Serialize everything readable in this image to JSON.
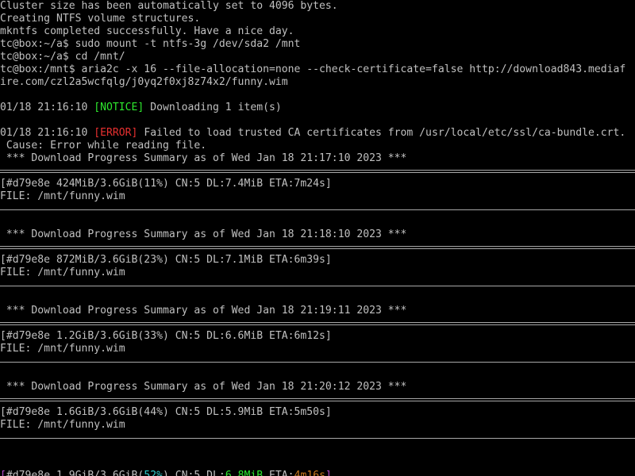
{
  "terminal": {
    "lines": [
      "Cluster size has been automatically set to 4096 bytes.",
      "Creating NTFS volume structures.",
      "mkntfs completed successfully. Have a nice day.",
      "tc@box:~/a$ sudo mount -t ntfs-3g /dev/sda2 /mnt",
      "tc@box:~/a$ cd /mnt/",
      "tc@box:/mnt$ aria2c -x 16 --file-allocation=none --check-certificate=false http://download843.mediaf",
      "ire.com/czl2a5wcfqlg/j0yq2f0xj8z74x2/funny.wim"
    ],
    "notice_line": {
      "time": "01/18 21:16:10 ",
      "tag": "[NOTICE]",
      "msg": " Downloading 1 item(s)"
    },
    "error_line": {
      "time": "01/18 21:16:10 ",
      "tag": "[ERROR]",
      "msg": " Failed to load trusted CA certificates from /usr/local/etc/ssl/ca-bundle.crt."
    },
    "cause_line": " Cause: Error while reading file.",
    "summaries": [
      {
        "header": " *** Download Progress Summary as of Wed Jan 18 21:17:10 2023 ***",
        "progress": "[#d79e8e 424MiB/3.6GiB(11%) CN:5 DL:7.4MiB ETA:7m24s]",
        "file": "FILE: /mnt/funny.wim"
      },
      {
        "header": " *** Download Progress Summary as of Wed Jan 18 21:18:10 2023 ***",
        "progress": "[#d79e8e 872MiB/3.6GiB(23%) CN:5 DL:7.1MiB ETA:6m39s]",
        "file": "FILE: /mnt/funny.wim"
      },
      {
        "header": " *** Download Progress Summary as of Wed Jan 18 21:19:11 2023 ***",
        "progress": "[#d79e8e 1.2GiB/3.6GiB(33%) CN:5 DL:6.6MiB ETA:6m12s]",
        "file": "FILE: /mnt/funny.wim"
      },
      {
        "header": " *** Download Progress Summary as of Wed Jan 18 21:20:12 2023 ***",
        "progress": "[#d79e8e 1.6GiB/3.6GiB(44%) CN:5 DL:5.9MiB ETA:5m50s]",
        "file": "FILE: /mnt/funny.wim"
      }
    ],
    "status_line": {
      "open_bracket": "[",
      "gid": "#d79e8e 1.9GiB/3.6GiB(",
      "percent": "52%",
      "close_paren": ") CN:5 DL:",
      "speed": "6.8MiB",
      "eta_label": " ETA:",
      "eta": "4m16s",
      "close_bracket": "]"
    }
  },
  "colors": {
    "background": "#000000",
    "text": "#c0c0c0",
    "notice": "#2ee82e",
    "error": "#e83030",
    "bracket": "#b44ac8",
    "percent": "#2ec8c8",
    "speed": "#2ee82e",
    "eta": "#c8781e"
  }
}
